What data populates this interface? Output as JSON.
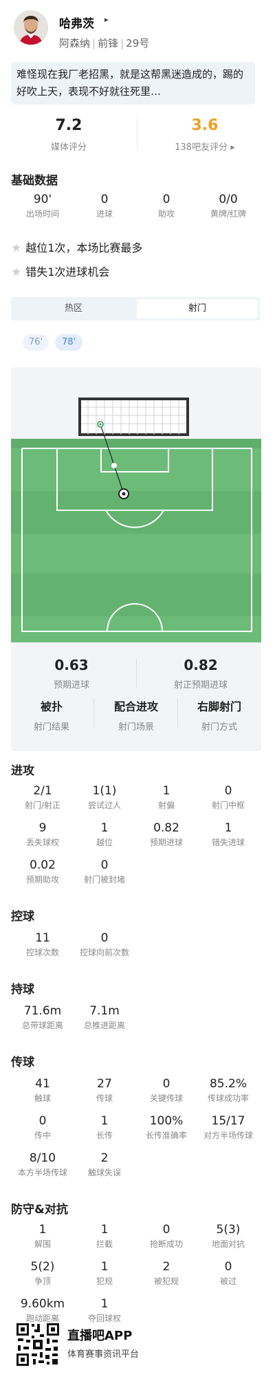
{
  "player": {
    "name": "哈弗茨",
    "caret": "▸",
    "club": "阿森纳",
    "position": "前锋",
    "number": "29号"
  },
  "comment": "难怪现在我厂老招黑，就是这帮黑迷造成的，踢的好吹上天，表现不好就往死里…",
  "ratings": {
    "media": {
      "value": "7.2",
      "label": "媒体评分"
    },
    "fans": {
      "value": "3.6",
      "label": "138吧友评分 ▸",
      "color": "#f0a020"
    }
  },
  "basic": {
    "title": "基础数据",
    "stats": [
      {
        "value": "90'",
        "label": "出场时间"
      },
      {
        "value": "0",
        "label": "进球"
      },
      {
        "value": "0",
        "label": "助攻"
      },
      {
        "value": "0/0",
        "label": "黄牌/红牌"
      }
    ]
  },
  "highlights": [
    "越位1次，本场比赛最多",
    "错失1次进球机会"
  ],
  "tabs": [
    {
      "label": "热区",
      "active": false
    },
    {
      "label": "射门",
      "active": true
    }
  ],
  "shot_times": [
    {
      "label": "76'",
      "active": false
    },
    {
      "label": "78'",
      "active": true
    }
  ],
  "shot": {
    "xg": {
      "value": "0.63",
      "label": "预期进球"
    },
    "xgot": {
      "value": "0.82",
      "label": "射正预期进球"
    },
    "result": {
      "value": "被扑",
      "label": "射门结果"
    },
    "situation": {
      "value": "配合进攻",
      "label": "射门场景"
    },
    "body_part": {
      "value": "右脚射门",
      "label": "射门方式"
    }
  },
  "sections": [
    {
      "title": "进攻",
      "rows": [
        [
          {
            "value": "2/1",
            "label": "射门/射正"
          },
          {
            "value": "1(1)",
            "label": "尝试过人"
          },
          {
            "value": "1",
            "label": "射偏"
          },
          {
            "value": "0",
            "label": "射门中框"
          }
        ],
        [
          {
            "value": "9",
            "label": "丢失球权"
          },
          {
            "value": "1",
            "label": "越位"
          },
          {
            "value": "0.82",
            "label": "预期进球"
          },
          {
            "value": "1",
            "label": "错失进球"
          }
        ],
        [
          {
            "value": "0.02",
            "label": "预期助攻"
          },
          {
            "value": "0",
            "label": "射门被封堵"
          }
        ]
      ]
    },
    {
      "title": "控球",
      "rows": [
        [
          {
            "value": "11",
            "label": "控球次数"
          },
          {
            "value": "0",
            "label": "控球向前次数"
          }
        ]
      ]
    },
    {
      "title": "持球",
      "rows": [
        [
          {
            "value": "71.6m",
            "label": "总带球距离"
          },
          {
            "value": "7.1m",
            "label": "总推进距离"
          }
        ]
      ]
    },
    {
      "title": "传球",
      "rows": [
        [
          {
            "value": "41",
            "label": "触球"
          },
          {
            "value": "27",
            "label": "传球"
          },
          {
            "value": "0",
            "label": "关键传球"
          },
          {
            "value": "85.2%",
            "label": "传球成功率"
          }
        ],
        [
          {
            "value": "0",
            "label": "传中"
          },
          {
            "value": "1",
            "label": "长传"
          },
          {
            "value": "100%",
            "label": "长传准确率"
          },
          {
            "value": "15/17",
            "label": "对方半场传球"
          }
        ],
        [
          {
            "value": "8/10",
            "label": "本方半场传球"
          },
          {
            "value": "2",
            "label": "触球失误"
          }
        ]
      ]
    },
    {
      "title": "防守&对抗",
      "rows": [
        [
          {
            "value": "1",
            "label": "解围"
          },
          {
            "value": "1",
            "label": "拦截"
          },
          {
            "value": "0",
            "label": "抢断成功"
          },
          {
            "value": "5(3)",
            "label": "地面对抗"
          }
        ],
        [
          {
            "value": "5(2)",
            "label": "争顶"
          },
          {
            "value": "1",
            "label": "犯规"
          },
          {
            "value": "2",
            "label": "被犯规"
          },
          {
            "value": "0",
            "label": "被过"
          }
        ],
        [
          {
            "value": "9.60km",
            "label": "跑动距离"
          },
          {
            "value": "1",
            "label": "夺回球权"
          }
        ]
      ]
    }
  ],
  "footer": {
    "app_name": "直播吧APP",
    "app_subtitle": "体育赛事资讯平台"
  },
  "colors": {
    "pitch_green": "#6cbb78",
    "pitch_stripe": "#63b26f",
    "fans_rating": "#f0a020",
    "accent_blue": "#4a83d6"
  }
}
